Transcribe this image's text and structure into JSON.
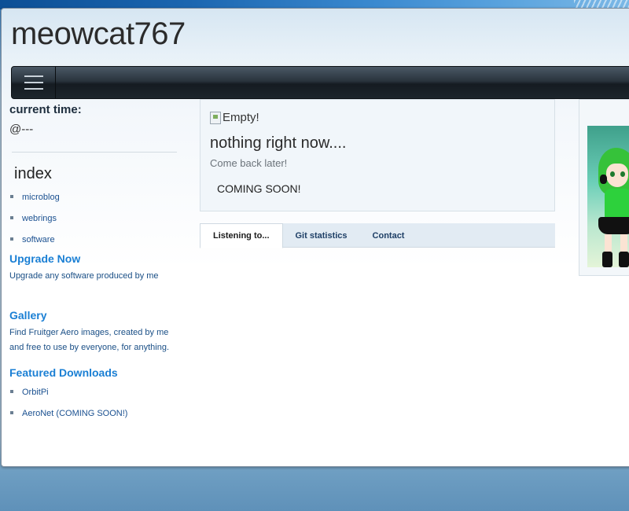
{
  "site": {
    "title": "meowcat767"
  },
  "navbar": {
    "menu_icon": "hamburger-menu-icon"
  },
  "sidebar": {
    "current_time_label": "current time:",
    "current_time_value": "@---",
    "index_heading": "index",
    "index_items": [
      "microblog",
      "webrings",
      "software"
    ],
    "upgrade": {
      "heading": "Upgrade Now",
      "text": "Upgrade any software produced by me"
    },
    "gallery": {
      "heading": "Gallery",
      "text": "Find Fruitger Aero images, created by me and free to use by everyone, for anything."
    },
    "downloads": {
      "heading": "Featured Downloads",
      "items": [
        "OrbitPi",
        "AeroNet (COMING SOON!)"
      ]
    }
  },
  "main": {
    "broken_image_alt": "Empty!",
    "title": "nothing right now....",
    "subtitle": "Come back later!",
    "coming_soon": "COMING SOON!",
    "tabs": [
      {
        "label": "Listening to...",
        "active": true
      },
      {
        "label": "Git statistics",
        "active": false
      },
      {
        "label": "Contact",
        "active": false
      }
    ]
  },
  "colors": {
    "link_blue": "#1a7fd4",
    "navbar_dark": "#1c252c",
    "heading_dark": "#1d2d3d"
  }
}
